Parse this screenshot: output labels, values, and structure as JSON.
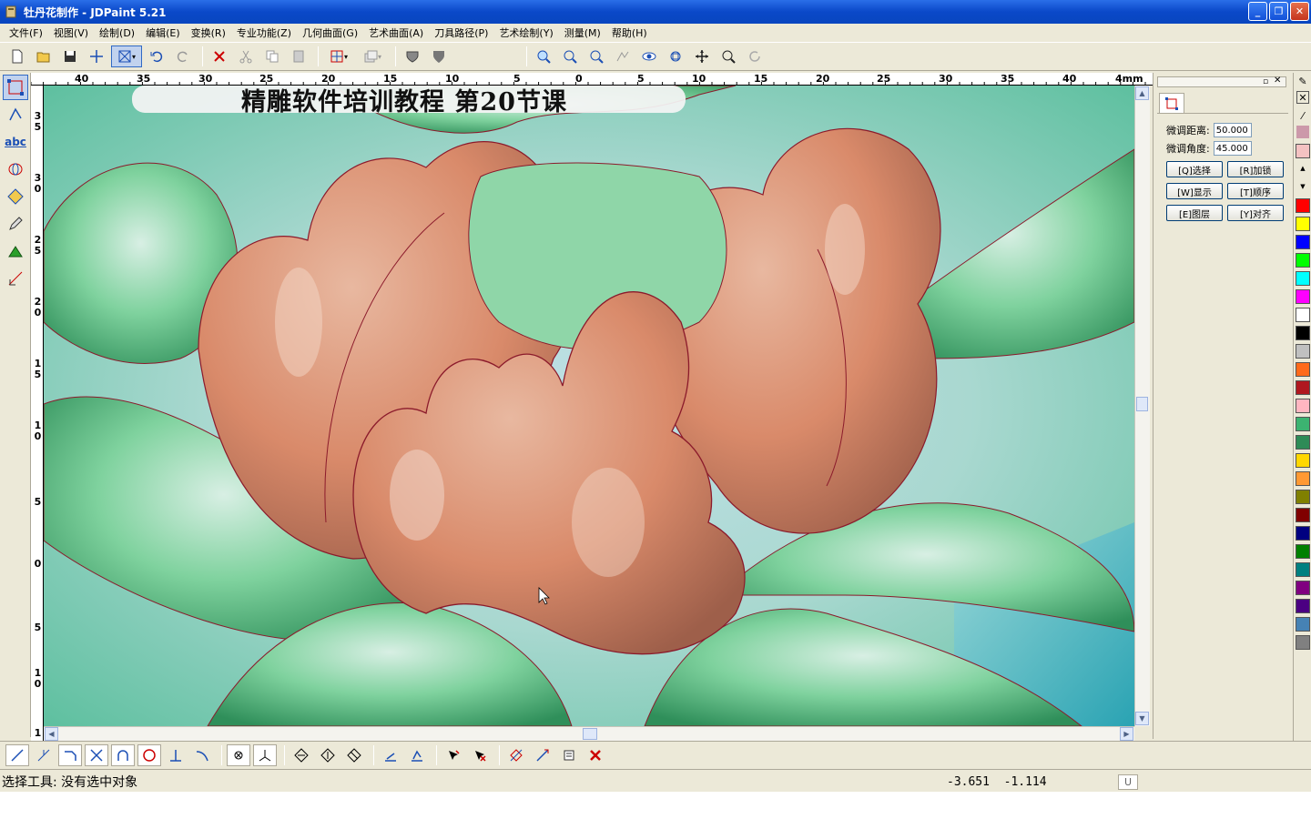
{
  "window": {
    "title": "牡丹花制作 - JDPaint 5.21",
    "min": "_",
    "max": "❐",
    "close": "✕"
  },
  "menu": [
    "文件(F)",
    "视图(V)",
    "绘制(D)",
    "编辑(E)",
    "变换(R)",
    "专业功能(Z)",
    "几何曲面(G)",
    "艺术曲面(A)",
    "刀具路径(P)",
    "艺术绘制(Y)",
    "测量(M)",
    "帮助(H)"
  ],
  "banner": "精雕软件培训教程  第20节课",
  "ruler_top": {
    "unit": "mm",
    "labels": [
      "40",
      "35",
      "30",
      "25",
      "20",
      "15",
      "10",
      "5",
      "0",
      "5",
      "10",
      "15",
      "20",
      "25",
      "30",
      "35",
      "40",
      "4mm"
    ]
  },
  "ruler_left": {
    "labels": [
      "3\n5",
      "3\n0",
      "2\n5",
      "2\n0",
      "1\n5",
      "1\n0",
      "5",
      "0",
      "5",
      "1\n0",
      "1"
    ]
  },
  "panel": {
    "dist_label": "微调距离:",
    "dist_value": "50.000",
    "angle_label": "微调角度:",
    "angle_value": "45.000",
    "buttons": [
      "[Q]选择",
      "[R]加锁",
      "[W]显示",
      "[T]顺序",
      "[E]图层",
      "[Y]对齐"
    ]
  },
  "palette": [
    "#ff0000",
    "#ffff00",
    "#0000ff",
    "#00ff00",
    "#00ffff",
    "#ff00ff",
    "#ffffff",
    "#000000",
    "#c0c0c0",
    "#ff6a1a",
    "#b0171f",
    "#ffb6c1",
    "#3cb371",
    "#2e8b57",
    "#ffd700",
    "#ff9933",
    "#808000",
    "#800000",
    "#000080",
    "#008000",
    "#008080",
    "#800080",
    "#4b0082",
    "#4682b4",
    "#808080"
  ],
  "status": {
    "text": "选择工具: 没有选中对象",
    "x": "-3.651",
    "y": "-1.114",
    "unit_toggle": "U"
  },
  "icons": {
    "toolbar": [
      "new-file-icon",
      "open-folder-icon",
      "save-icon",
      "crosshair-icon",
      "select-box-icon",
      "undo-icon",
      "redo-icon",
      "delete-icon",
      "cut-icon",
      "copy-icon",
      "paste-icon",
      "snap-grid-icon",
      "layer-icon",
      "shield-icon",
      "shield-filled-icon",
      "zoom-window-icon",
      "zoom-in-icon",
      "zoom-out-icon",
      "zoom-all-icon",
      "view-eye-icon",
      "zoom-fit-icon",
      "pan-icon",
      "zoom-realtime-icon",
      "rotate-view-icon"
    ],
    "left": [
      "select-tool-icon",
      "node-edit-icon",
      "text-tool-icon",
      "cylinder-icon",
      "cube-icon",
      "pen-icon",
      "sculpt-icon",
      "measure-icon"
    ]
  }
}
